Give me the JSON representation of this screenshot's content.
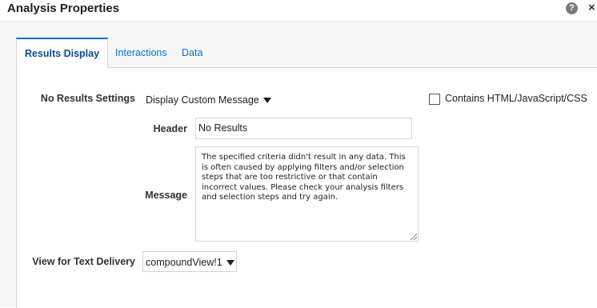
{
  "dialog": {
    "title": "Analysis Properties",
    "help_icon": "question-circle-icon",
    "close_icon": "close-icon",
    "help_glyph": "?",
    "close_glyph": "×"
  },
  "tabs": [
    {
      "label": "Results Display",
      "active": true
    },
    {
      "label": "Interactions",
      "active": false
    },
    {
      "label": "Data",
      "active": false
    }
  ],
  "form": {
    "no_results_label": "No Results Settings",
    "no_results_value": "Display Custom Message",
    "contains_html_label": "Contains HTML/JavaScript/CSS",
    "contains_html_checked": false,
    "header_label": "Header",
    "header_value": "No Results",
    "message_label": "Message",
    "message_value": "The specified criteria didn't result in any data. This is often caused by applying filters and/or selection steps that are too restrictive or that contain incorrect values. Please check your analysis filters and selection steps and try again.",
    "text_delivery_label": "View for Text Delivery",
    "text_delivery_value": "compoundView!1"
  },
  "colors": {
    "accent": "#0572ce",
    "panel_bg": "#ffffff",
    "dialog_bg": "#f7f7f7"
  }
}
